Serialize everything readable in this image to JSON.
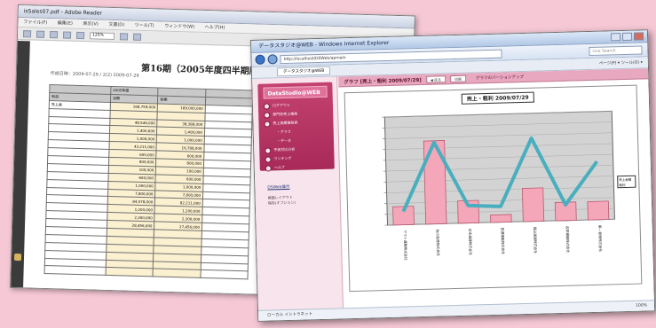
{
  "background_window": {
    "title": "isSales07.pdf - Adobe Reader",
    "menu": [
      "ファイル(F)",
      "編集(E)",
      "表示(V)",
      "文書(D)",
      "ツール(T)",
      "ウィンドウ(W)",
      "ヘルプ(H)"
    ],
    "zoom": "125%",
    "document_title": "第16期（2005年度四半期版）",
    "document_subtitle": "作成日時：2009-07-29 / 2(2) 2009-07-29",
    "table_rows": [
      [
        "",
        "2005年度",
        "",
        ""
      ],
      [
        "科目",
        "当期",
        "前期",
        ""
      ],
      [
        "売上高",
        "168,759,000",
        "189,000,000",
        ""
      ],
      [
        "",
        "",
        "",
        ""
      ],
      [
        "",
        "48,546,000",
        "38,388,000",
        ""
      ],
      [
        "",
        "1,400,600",
        "1,400,000",
        ""
      ],
      [
        "",
        "1,000,000",
        "1,000,000",
        ""
      ],
      [
        "",
        "43,211,000",
        "16,788,000",
        ""
      ],
      [
        "",
        "600,000",
        "600,000",
        ""
      ],
      [
        "",
        "800,000",
        "800,000",
        ""
      ],
      [
        "",
        "100,000",
        "100,000",
        ""
      ],
      [
        "",
        "600,000",
        "600,000",
        ""
      ],
      [
        "",
        "1,000,000",
        "1,000,000",
        ""
      ],
      [
        "",
        "7,800,000",
        "7,800,000",
        ""
      ],
      [
        "",
        "84,578,000",
        "82,211,000",
        ""
      ],
      [
        "",
        "1,200,000",
        "1,200,000",
        ""
      ],
      [
        "",
        "2,300,000",
        "2,300,000",
        ""
      ],
      [
        "",
        "28,456,000",
        "27,456,000",
        ""
      ],
      [
        "",
        "",
        "",
        ""
      ],
      [
        "",
        "",
        "",
        ""
      ],
      [
        "",
        "",
        "",
        ""
      ],
      [
        "",
        "",
        "",
        ""
      ],
      [
        "",
        "",
        "",
        ""
      ],
      [
        "",
        "",
        "",
        ""
      ]
    ]
  },
  "ie_window": {
    "title": "データスタジオ@WEB - Windows Internet Explorer",
    "url": "http://localhost/DSWeb/apmain",
    "search_placeholder": "Live Search",
    "tab_label": "データスタジオ@WEB",
    "toolbar_right": "ページ(P) ▾  ツール(O) ▾",
    "status_text": "ローカル イントラネット",
    "zoom_text": "100%"
  },
  "sidebar": {
    "brand": "DataStudio@WEB",
    "items": [
      {
        "label": "ログアウト"
      },
      {
        "label": "部門別売上推移"
      },
      {
        "label": "売上実績推移表"
      },
      {
        "label": "・グラフ",
        "sub": true
      },
      {
        "label": "・データ",
        "sub": true
      },
      {
        "label": "予実対比分析"
      },
      {
        "label": "ランキング"
      },
      {
        "label": "ヘルプ"
      }
    ],
    "link": "DSWeb操作",
    "note": [
      "画面レイアウト",
      "保存(オプション)"
    ]
  },
  "graph_page": {
    "header_title": "グラフ [売上・粗利 2009/07/29]",
    "buttons": [
      "◀ 戻る",
      "印刷"
    ],
    "tab": "グラフのバーションアップ",
    "chart_title": "売上・粗利 2009/07/29",
    "legend": [
      "売上金額",
      "粗利"
    ]
  },
  "chart_data": {
    "type": "bar",
    "title": "売上・粗利 2009/07/29",
    "categories": [
      "ヤマト運輸株式会社",
      "佐川急便株式会社",
      "日本通運株式会社",
      "西濃運輸株式会社",
      "福山通運株式会社",
      "名鉄運輸株式会社",
      "第一貨物株式会社"
    ],
    "series": [
      {
        "name": "売上金額",
        "type": "bar",
        "values": [
          22,
          100,
          27,
          9,
          40,
          22,
          22
        ]
      },
      {
        "name": "粗利",
        "type": "line",
        "values": [
          16,
          98,
          21,
          19,
          100,
          19,
          70
        ]
      }
    ],
    "ylim": [
      0,
      130
    ],
    "colors": {
      "bar": "#f4a7b9",
      "line": "#49aebe"
    },
    "grid": true,
    "legend_placement": "right"
  }
}
